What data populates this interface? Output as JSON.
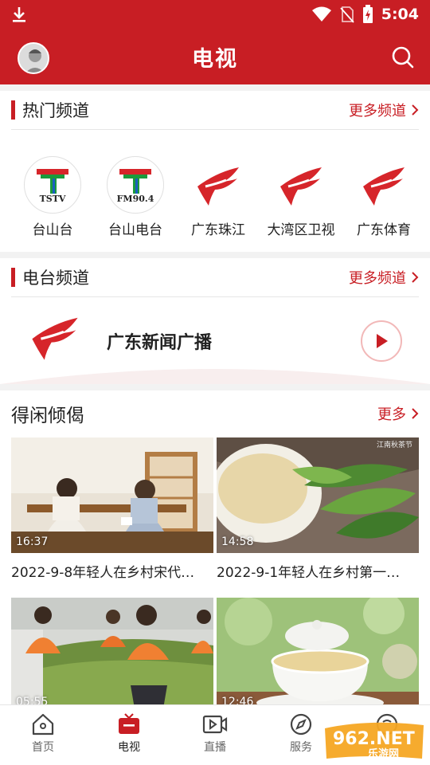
{
  "status_bar": {
    "time": "5:04"
  },
  "header": {
    "title": "电视"
  },
  "hot_channels": {
    "title": "热门频道",
    "more_label": "更多频道",
    "items": [
      {
        "name": "台山台",
        "tag": "TSTV",
        "icon": "tstv-logo"
      },
      {
        "name": "台山电台",
        "tag": "FM90.4",
        "icon": "fm904-logo"
      },
      {
        "name": "广东珠江",
        "icon": "gdtv-logo"
      },
      {
        "name": "大湾区卫视",
        "icon": "gdtv-logo"
      },
      {
        "name": "广东体育",
        "icon": "gdtv-logo"
      }
    ]
  },
  "radio_channels": {
    "title": "电台频道",
    "more_label": "更多频道",
    "item": {
      "name": "广东新闻广播",
      "icon": "gdtv-logo"
    }
  },
  "leisure": {
    "title": "得闲倾偈",
    "more_label": "更多",
    "videos": [
      {
        "duration": "16:37",
        "title": "2022-9-8年轻人在乡村宋代…"
      },
      {
        "duration": "14:58",
        "title": "2022-9-1年轻人在乡村第一…",
        "overlay": "江南秋茶节"
      },
      {
        "duration": "05:55",
        "title": ""
      },
      {
        "duration": "12:46",
        "title": ""
      }
    ]
  },
  "bottom_nav": {
    "items": [
      {
        "label": "首页",
        "icon": "home-icon"
      },
      {
        "label": "电视",
        "icon": "tv-icon",
        "active": true
      },
      {
        "label": "直播",
        "icon": "live-video-icon"
      },
      {
        "label": "服务",
        "icon": "compass-icon"
      },
      {
        "label": "",
        "icon": "profile-icon"
      }
    ]
  },
  "watermark": {
    "logo": "962.NET",
    "text": "乐游网"
  },
  "colors": {
    "brand_red": "#c81e24"
  }
}
